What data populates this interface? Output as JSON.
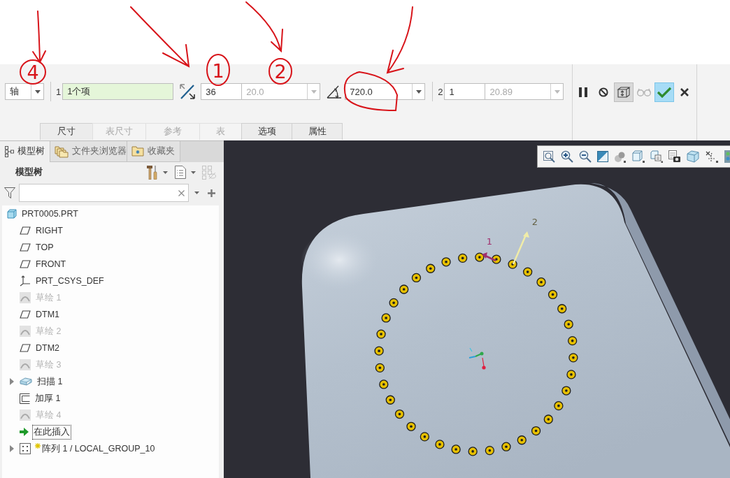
{
  "annotations": [
    {
      "label": "4"
    },
    {
      "label": "1"
    },
    {
      "label": "2"
    }
  ],
  "dashboard": {
    "reference_type": {
      "value": "轴"
    },
    "direction_1": {
      "index": "1",
      "collector": "1个项",
      "count": "36",
      "spacing": {
        "value": "20.0",
        "disabled": true
      }
    },
    "angle": {
      "extent": "720.0"
    },
    "direction_2": {
      "index": "2",
      "count": "1",
      "spacing": {
        "value": "20.89",
        "disabled": true
      }
    },
    "actions": [
      {
        "kind": "pause",
        "on": false,
        "disabled": false
      },
      {
        "kind": "stop",
        "on": false,
        "disabled": false
      },
      {
        "kind": "preview",
        "on": true,
        "disabled": false
      },
      {
        "kind": "glasses",
        "on": false,
        "disabled": true
      },
      {
        "kind": "confirm",
        "on": false,
        "disabled": false
      },
      {
        "kind": "cancel",
        "on": false,
        "disabled": false
      }
    ],
    "tabs": [
      {
        "label": "尺寸",
        "disabled": false
      },
      {
        "label": "表尺寸",
        "disabled": true
      },
      {
        "label": "参考",
        "disabled": true
      },
      {
        "label": "表",
        "disabled": true
      },
      {
        "label": "选项",
        "disabled": false
      },
      {
        "label": "属性",
        "disabled": false
      }
    ]
  },
  "sidebar": {
    "tabs": [
      {
        "label": "模型树",
        "kind": "tree",
        "selected": true
      },
      {
        "label": "文件夹浏览器",
        "kind": "folders",
        "selected": false
      },
      {
        "label": "收藏夹",
        "kind": "favorites",
        "selected": false
      }
    ],
    "title": "模型树",
    "tree": [
      {
        "label": "PRT0005.PRT",
        "kind": "part",
        "dimmed": false,
        "editing": false,
        "children": [
          {
            "label": "RIGHT",
            "kind": "datum-plane",
            "dimmed": false,
            "editing": false
          },
          {
            "label": "TOP",
            "kind": "datum-plane",
            "dimmed": false,
            "editing": false
          },
          {
            "label": "FRONT",
            "kind": "datum-plane",
            "dimmed": false,
            "editing": false
          },
          {
            "label": "PRT_CSYS_DEF",
            "kind": "csys",
            "dimmed": false,
            "editing": false
          },
          {
            "label": "草绘 1",
            "kind": "sketch",
            "dimmed": true,
            "editing": false
          },
          {
            "label": "DTM1",
            "kind": "datum-plane",
            "dimmed": false,
            "editing": false
          },
          {
            "label": "草绘 2",
            "kind": "sketch",
            "dimmed": true,
            "editing": false
          },
          {
            "label": "DTM2",
            "kind": "datum-plane",
            "dimmed": false,
            "editing": false
          },
          {
            "label": "草绘 3",
            "kind": "sketch",
            "dimmed": true,
            "editing": false
          },
          {
            "label": "扫描 1",
            "kind": "sweep",
            "dimmed": false,
            "editing": false,
            "expanded": false
          },
          {
            "label": "加厚 1",
            "kind": "thicken",
            "dimmed": false,
            "editing": false
          },
          {
            "label": "草绘 4",
            "kind": "sketch",
            "dimmed": true,
            "editing": false
          },
          {
            "label": "在此插入",
            "kind": "insert",
            "dimmed": false,
            "editing": false
          },
          {
            "label": "阵列 1 / LOCAL_GROUP_10",
            "kind": "pattern",
            "dimmed": false,
            "editing": true,
            "expanded": false
          }
        ]
      }
    ]
  },
  "viewport": {
    "direction_labels": [
      {
        "label": "1",
        "color": "#a0306e"
      },
      {
        "label": "2",
        "color": "#f0eca8"
      }
    ]
  }
}
